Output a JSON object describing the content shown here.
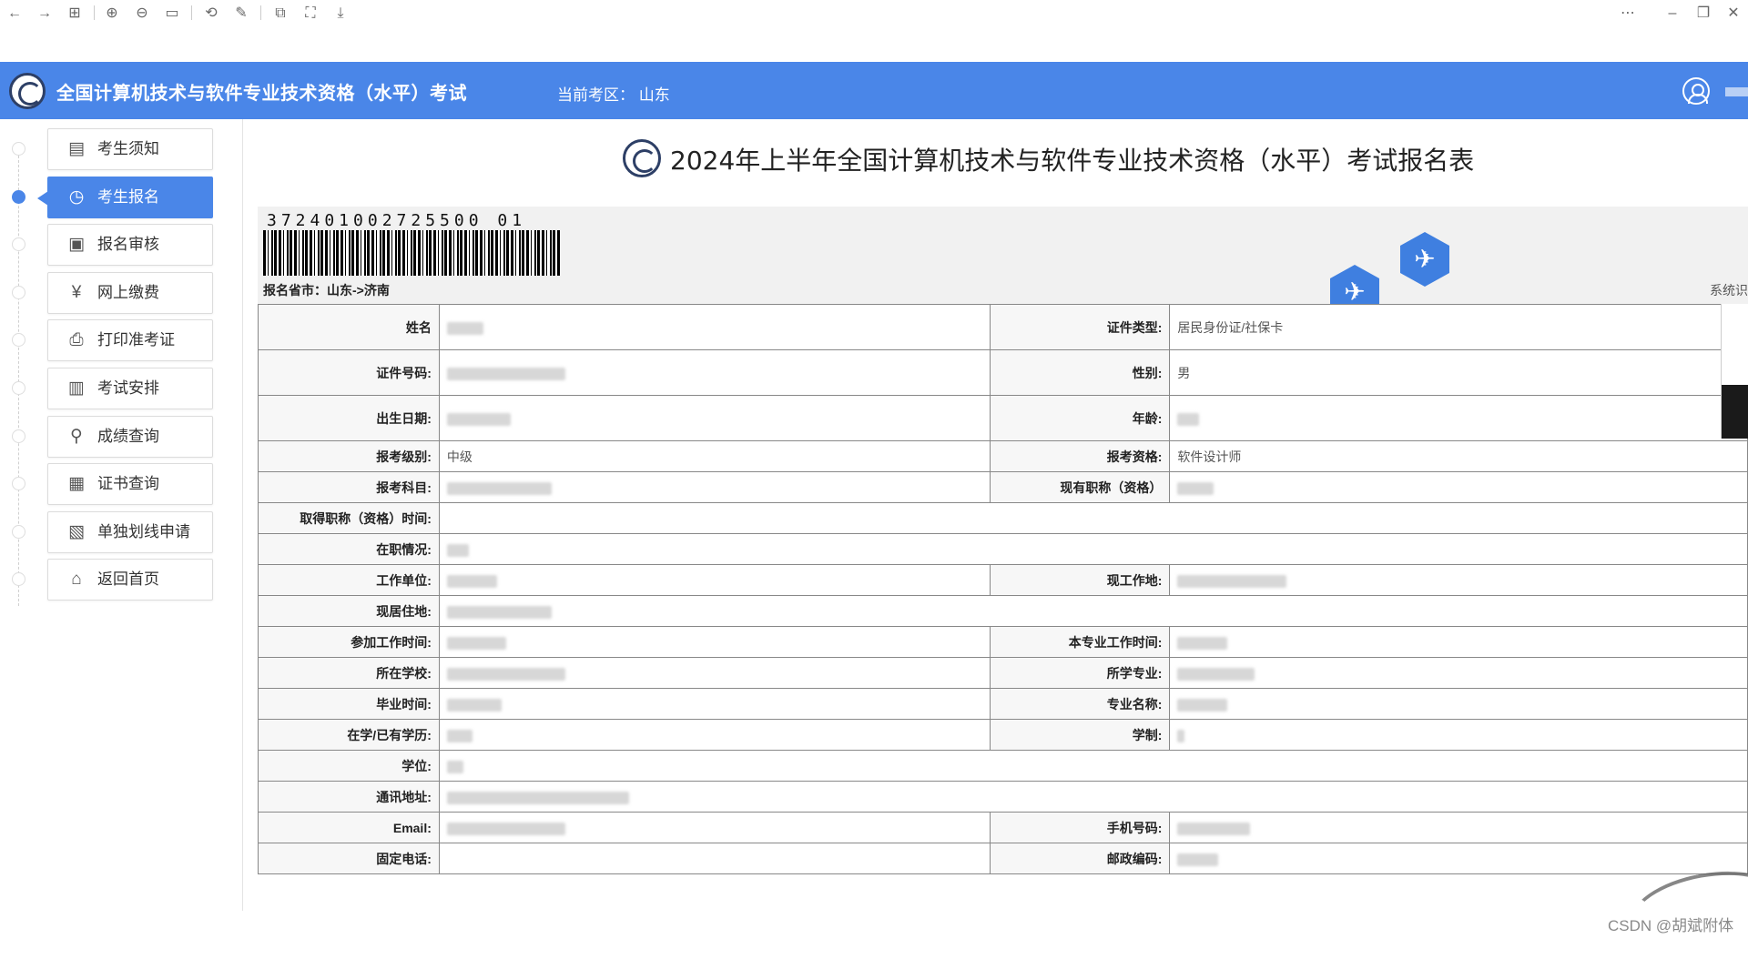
{
  "viewer": {
    "icons": [
      "back-arrow-icon",
      "forward-arrow-icon",
      "grid-icon",
      "zoom-in-icon",
      "zoom-out-icon",
      "fit-icon",
      "rotate-icon",
      "edit-icon",
      "crop-icon",
      "fullscreen-icon",
      "save-icon",
      "more-icon",
      "minimize-icon",
      "restore-icon",
      "close-icon"
    ]
  },
  "header": {
    "title": "全国计算机技术与软件专业技术资格（水平）考试",
    "region_label": "当前考区：  山东"
  },
  "sidebar": {
    "items": [
      {
        "label": "考生须知",
        "icon": "notice-icon",
        "glyph": "▤"
      },
      {
        "label": "考生报名",
        "icon": "clock-icon",
        "glyph": "◷"
      },
      {
        "label": "报名审核",
        "icon": "review-icon",
        "glyph": "▣"
      },
      {
        "label": "网上缴费",
        "icon": "payment-icon",
        "glyph": "¥"
      },
      {
        "label": "打印准考证",
        "icon": "printer-icon",
        "glyph": "⎙"
      },
      {
        "label": "考试安排",
        "icon": "schedule-icon",
        "glyph": "▥"
      },
      {
        "label": "成绩查询",
        "icon": "search-icon",
        "glyph": "⚲"
      },
      {
        "label": "证书查询",
        "icon": "certificate-icon",
        "glyph": "▦"
      },
      {
        "label": "单独划线申请",
        "icon": "application-icon",
        "glyph": "▧"
      },
      {
        "label": "返回首页",
        "icon": "home-icon",
        "glyph": "⌂"
      }
    ],
    "active_index": 1
  },
  "form": {
    "title": "2024年上半年全国计算机技术与软件专业技术资格（水平）考试报名表",
    "barcode_number": "372401002725500 01",
    "reg_place": "报名省市：山东->济南",
    "sys_label": "系统识",
    "rows": {
      "name_label": "姓名",
      "id_type_label": "证件类型:",
      "id_type_value": "居民身份证/社保卡",
      "id_no_label": "证件号码:",
      "gender_label": "性别:",
      "gender_value": "男",
      "birth_label": "出生日期:",
      "age_label": "年龄:",
      "level_label": "报考级别:",
      "level_value": "中级",
      "qual_label": "报考资格:",
      "qual_value": "软件设计师",
      "subject_label": "报考科目:",
      "title_label": "现有职称（资格）",
      "title_time_label": "取得职称（资格）时间:",
      "job_status_label": "在职情况:",
      "employer_label": "工作单位:",
      "work_place_label": "现工作地:",
      "residence_label": "现居住地:",
      "work_start_label": "参加工作时间:",
      "major_work_label": "本专业工作时间:",
      "school_label": "所在学校:",
      "major_label": "所学专业:",
      "grad_time_label": "毕业时间:",
      "major_name_label": "专业名称:",
      "edu_label": "在学/已有学历:",
      "school_length_label": "学制:",
      "degree_label": "学位:",
      "address_label": "通讯地址:",
      "email_label": "Email:",
      "phone_label": "手机号码:",
      "landline_label": "固定电话:",
      "postcode_label": "邮政编码:"
    }
  },
  "watermark": "CSDN @胡斌附体"
}
